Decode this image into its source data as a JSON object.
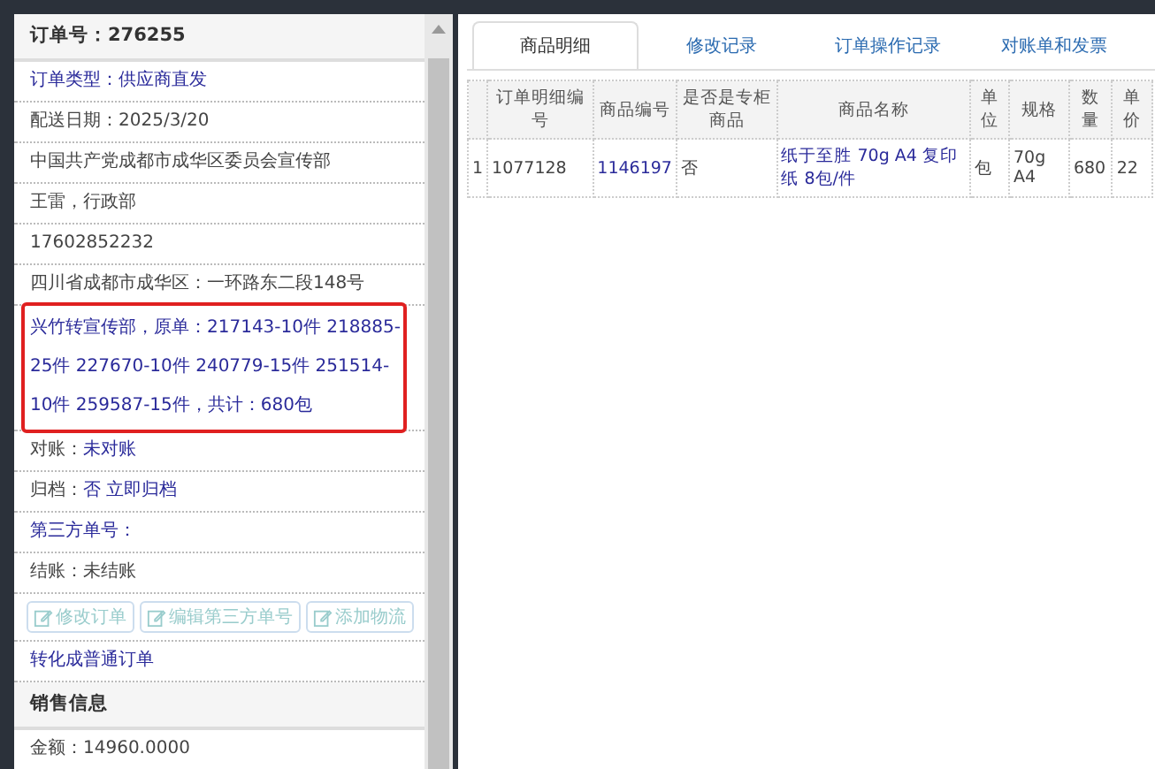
{
  "order_panel": {
    "title": "订单号：276255",
    "rows": [
      {
        "kind": "link",
        "text": "订单类型：供应商直发"
      },
      {
        "kind": "plain",
        "text": "配送日期：2025/3/20"
      },
      {
        "kind": "plain",
        "text": "中国共产党成都市成华区委员会宣传部"
      },
      {
        "kind": "plain",
        "text": "王雷，行政部"
      },
      {
        "kind": "plain",
        "text": "17602852232"
      },
      {
        "kind": "plain",
        "text": "四川省成都市成华区：一环路东二段148号"
      },
      {
        "kind": "note",
        "text": "兴竹转宣传部，原单：217143-10件 218885-25件 227670-10件 240779-15件 251514-10件 259587-15件，共计：680包",
        "highlighted": true
      },
      {
        "kind": "pair",
        "label": "对账：",
        "text": "未对账"
      },
      {
        "kind": "pair",
        "label": "归档：",
        "text": "否 立即归档"
      },
      {
        "kind": "link",
        "text": "第三方单号："
      },
      {
        "kind": "plain",
        "text": "结账：未结账"
      },
      {
        "kind": "buttons",
        "buttons": [
          "修改订单",
          "编辑第三方单号",
          "添加物流"
        ]
      },
      {
        "kind": "link",
        "text": "转化成普通订单"
      }
    ],
    "sales_section": {
      "title": "销售信息",
      "rows": [
        "金额：14960.0000"
      ]
    }
  },
  "tabs": [
    {
      "label": "商品明细",
      "selected": true
    },
    {
      "label": "修改记录",
      "selected": false
    },
    {
      "label": "订单操作记录",
      "selected": false
    },
    {
      "label": "对账单和发票",
      "selected": false
    }
  ],
  "table": {
    "columns": [
      "",
      "订单明细编号",
      "商品编号",
      "是否是专柜商品",
      "商品名称",
      "单位",
      "规格",
      "数量",
      "单价"
    ],
    "rows": [
      [
        "1",
        "1077128",
        "1146197",
        "否",
        "纸于至胜 70g A4 复印纸 8包/件",
        "包",
        "70g A4",
        "680",
        "22"
      ]
    ]
  }
}
